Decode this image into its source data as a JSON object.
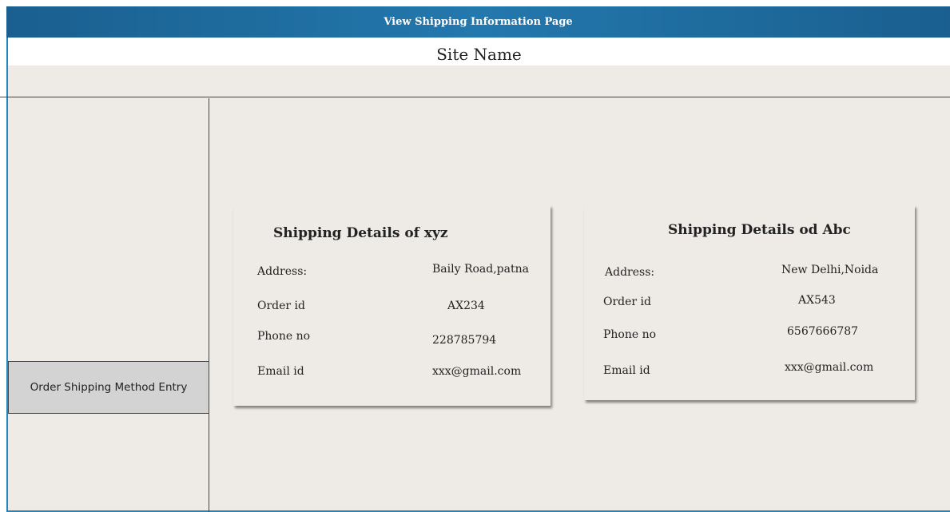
{
  "window": {
    "title": "View Shipping Information Page"
  },
  "header": {
    "site_name": "Site Name"
  },
  "sidebar": {
    "order_button_label": "Order Shipping Method Entry"
  },
  "cards": [
    {
      "title": "Shipping Details of xyz",
      "fields": [
        {
          "label": "Address:",
          "value": "Baily Road,patna"
        },
        {
          "label": "Order id",
          "value": "AX234"
        },
        {
          "label": "Phone no",
          "value": "228785794"
        },
        {
          "label": "Email id",
          "value": "xxx@gmail.com"
        }
      ]
    },
    {
      "title": "Shipping Details od Abc",
      "fields": [
        {
          "label": "Address:",
          "value": "New Delhi,Noida"
        },
        {
          "label": "Order id",
          "value": "AX543"
        },
        {
          "label": "Phone no",
          "value": "6567666787"
        },
        {
          "label": "Email id",
          "value": "xxx@gmail.com"
        }
      ]
    }
  ],
  "colors": {
    "title_bar": "#2378ad",
    "frame_border": "#1f86c4",
    "background": "#eeebe6",
    "button": "#d3d3d3"
  }
}
